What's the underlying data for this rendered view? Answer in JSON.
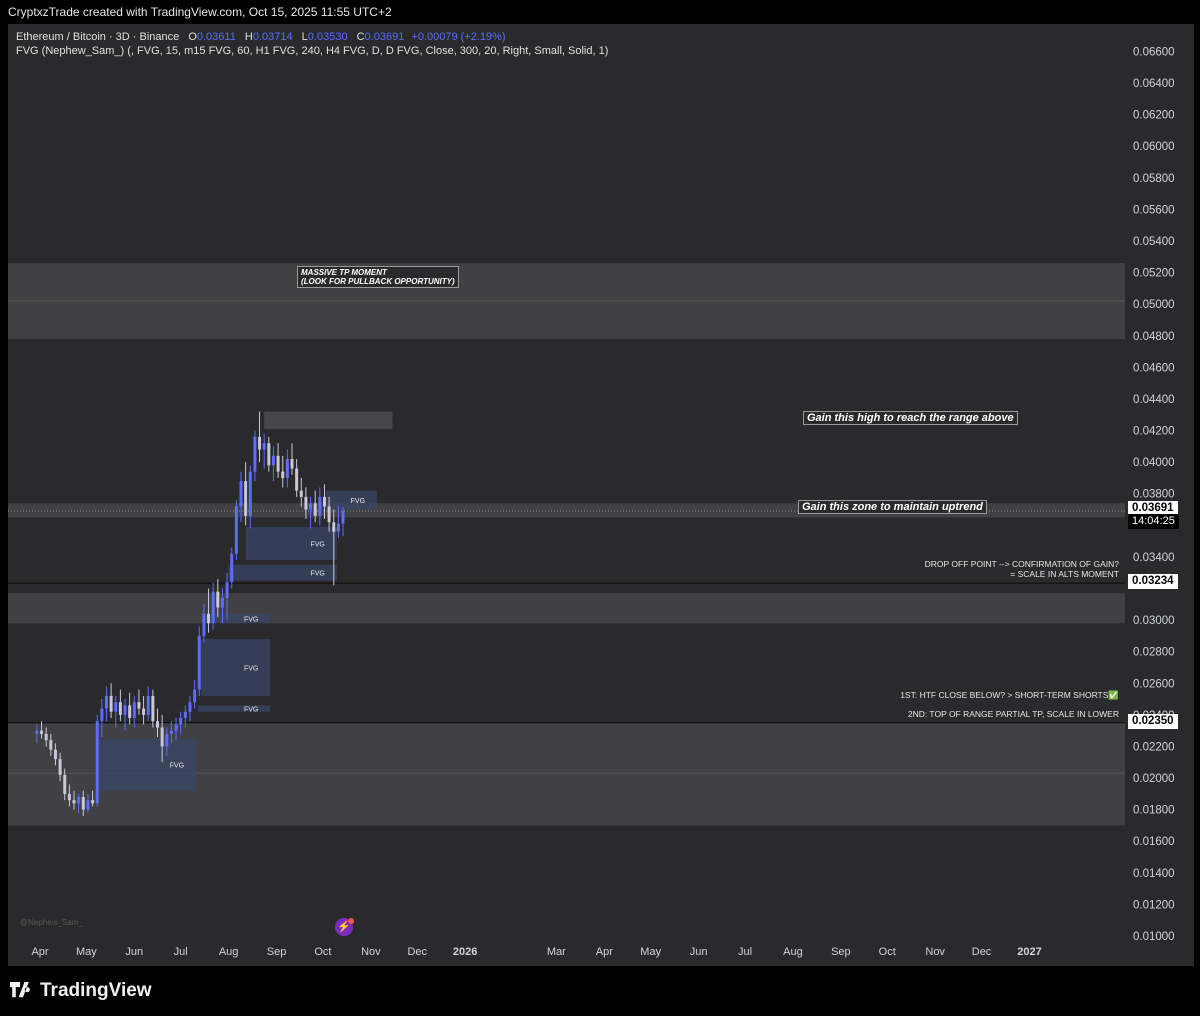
{
  "attribution": "CryptxzTrade created with TradingView.com, Oct 15, 2025 11:55 UTC+2",
  "legend": {
    "symbol": "Ethereum / Bitcoin · 3D · Binance",
    "open_label": "O",
    "open": "0.03611",
    "high_label": "H",
    "high": "0.03714",
    "low_label": "L",
    "low": "0.03530",
    "close_label": "C",
    "close": "0.03691",
    "change": "+0.00079 (+2.19%)",
    "indicator": "FVG (Nephew_Sam_) (, FVG, 15, m15 FVG, 60, H1 FVG, 240, H4 FVG, D, D FVG, Close, 300, 20, Right, Small, Solid, 1)"
  },
  "annotations": {
    "massive_tp_line1": "MASSIVE TP MOMENT",
    "massive_tp_line2": "(LOOK FOR PULLBACK OPPORTUNITY)",
    "gain_high": "Gain this high to reach the range above",
    "gain_zone": "Gain this zone to maintain uptrend",
    "drop_off_line1": "DROP OFF POINT -->  CONFIRMATION OF GAIN?",
    "drop_off_line2": "= SCALE IN ALTS MOMENT",
    "first_note": "1ST: HTF CLOSE BELOW? > SHORT-TERM SHORTS✅",
    "second_note": "2ND: TOP OF RANGE PARTIAL TP, SCALE IN LOWER",
    "fvg_label": "FVG"
  },
  "price_tags": {
    "current": "0.03691",
    "countdown": "14:04:25",
    "drop_level": "0.03234",
    "range_top": "0.02350"
  },
  "watermark": "@Nephew_Sam_",
  "brand": "TradingView",
  "colors": {
    "background": "#2a2a2c",
    "candle_up": "#5b6cff",
    "candle_down": "#c8c8d8",
    "fvg_fill": "#3a4566",
    "zone_fill": "#4a4a4c"
  },
  "chart_data": {
    "type": "candlestick",
    "symbol": "ETH/BTC",
    "timeframe": "3D",
    "y_axis": {
      "range": [
        0.01,
        0.0666
      ],
      "tick_labels": [
        "0.06600",
        "0.06400",
        "0.06200",
        "0.06000",
        "0.05800",
        "0.05600",
        "0.05400",
        "0.05200",
        "0.05000",
        "0.04800",
        "0.04600",
        "0.04400",
        "0.04200",
        "0.04000",
        "0.03800",
        "0.03400",
        "0.03000",
        "0.02800",
        "0.02600",
        "0.02400",
        "0.02200",
        "0.02000",
        "0.01800",
        "0.01600",
        "0.01400",
        "0.01200",
        "0.01000"
      ],
      "tick_values": [
        0.066,
        0.064,
        0.062,
        0.06,
        0.058,
        0.056,
        0.054,
        0.052,
        0.05,
        0.048,
        0.046,
        0.044,
        0.042,
        0.04,
        0.038,
        0.034,
        0.03,
        0.028,
        0.026,
        0.024,
        0.022,
        0.02,
        0.018,
        0.016,
        0.014,
        0.012,
        0.01
      ]
    },
    "x_axis": {
      "tick_labels": [
        "Apr",
        "May",
        "Jun",
        "Jul",
        "Aug",
        "Sep",
        "Oct",
        "Nov",
        "Dec",
        "2026",
        "Mar",
        "Apr",
        "May",
        "Jun",
        "Jul",
        "Aug",
        "Sep",
        "Oct",
        "Nov",
        "Dec",
        "2027"
      ],
      "tick_months": [
        "2025-04",
        "2025-05",
        "2025-06",
        "2025-07",
        "2025-08",
        "2025-09",
        "2025-10",
        "2025-11",
        "2025-12",
        "2026-01",
        "2026-03",
        "2026-04",
        "2026-05",
        "2026-06",
        "2026-07",
        "2026-08",
        "2026-09",
        "2026-10",
        "2026-11",
        "2026-12",
        "2027-01"
      ],
      "bold_labels": [
        "2026",
        "2027"
      ]
    },
    "zones": [
      {
        "name": "massive-tp-zone",
        "from": 0.0478,
        "to": 0.0526
      },
      {
        "name": "high-zone",
        "from": 0.0421,
        "to": 0.0432,
        "start": "2025-08-24",
        "end": "2025-11-15"
      },
      {
        "name": "uptrend-zone",
        "from": 0.0365,
        "to": 0.0374
      },
      {
        "name": "drop-off-zone",
        "from": 0.0298,
        "to": 0.0317
      },
      {
        "name": "bottom-range",
        "from": 0.017,
        "to": 0.0235
      }
    ],
    "levels": [
      {
        "name": "current-close",
        "value": 0.03691
      },
      {
        "name": "drop-off-line",
        "value": 0.03234
      },
      {
        "name": "range-top-line",
        "value": 0.0235
      }
    ],
    "fvgs": [
      {
        "start": "2025-10-03",
        "end": "2025-11-05",
        "from": 0.037,
        "to": 0.0382
      },
      {
        "start": "2025-08-12",
        "end": "2025-10-10",
        "from": 0.0338,
        "to": 0.0359
      },
      {
        "start": "2025-08-01",
        "end": "2025-10-10",
        "from": 0.0325,
        "to": 0.0335
      },
      {
        "start": "2025-07-16",
        "end": "2025-08-28",
        "from": 0.0298,
        "to": 0.0304
      },
      {
        "start": "2025-07-14",
        "end": "2025-08-28",
        "from": 0.0252,
        "to": 0.0288
      },
      {
        "start": "2025-07-12",
        "end": "2025-08-28",
        "from": 0.0242,
        "to": 0.0246
      },
      {
        "start": "2025-05-08",
        "end": "2025-07-11",
        "from": 0.0192,
        "to": 0.0225
      }
    ],
    "ohlc": [
      [
        "2025-03-30",
        0.0228,
        0.0234,
        0.0222,
        0.023
      ],
      [
        "2025-04-02",
        0.023,
        0.0236,
        0.0225,
        0.0228
      ],
      [
        "2025-04-05",
        0.0228,
        0.0232,
        0.022,
        0.0224
      ],
      [
        "2025-04-08",
        0.0224,
        0.0228,
        0.0214,
        0.0218
      ],
      [
        "2025-04-11",
        0.0218,
        0.0222,
        0.0208,
        0.0212
      ],
      [
        "2025-04-14",
        0.0212,
        0.0216,
        0.0198,
        0.0202
      ],
      [
        "2025-04-17",
        0.0202,
        0.0206,
        0.0186,
        0.019
      ],
      [
        "2025-04-20",
        0.019,
        0.0196,
        0.0182,
        0.0186
      ],
      [
        "2025-04-23",
        0.0186,
        0.0192,
        0.018,
        0.0184
      ],
      [
        "2025-04-26",
        0.0184,
        0.019,
        0.0178,
        0.0188
      ],
      [
        "2025-04-29",
        0.0188,
        0.0192,
        0.0176,
        0.018
      ],
      [
        "2025-05-02",
        0.018,
        0.019,
        0.0178,
        0.0186
      ],
      [
        "2025-05-05",
        0.0186,
        0.0192,
        0.0182,
        0.0184
      ],
      [
        "2025-05-08",
        0.0184,
        0.024,
        0.0182,
        0.0236
      ],
      [
        "2025-05-11",
        0.0236,
        0.025,
        0.0226,
        0.0244
      ],
      [
        "2025-05-14",
        0.0244,
        0.0258,
        0.0236,
        0.0252
      ],
      [
        "2025-05-17",
        0.0252,
        0.026,
        0.0238,
        0.0242
      ],
      [
        "2025-05-20",
        0.0242,
        0.0252,
        0.0232,
        0.0248
      ],
      [
        "2025-05-23",
        0.0248,
        0.0256,
        0.0236,
        0.024
      ],
      [
        "2025-05-26",
        0.024,
        0.025,
        0.023,
        0.0246
      ],
      [
        "2025-05-29",
        0.0246,
        0.0254,
        0.0234,
        0.0238
      ],
      [
        "2025-06-01",
        0.0238,
        0.0252,
        0.0232,
        0.0248
      ],
      [
        "2025-06-04",
        0.0248,
        0.0256,
        0.024,
        0.0244
      ],
      [
        "2025-06-07",
        0.0244,
        0.0252,
        0.0234,
        0.024
      ],
      [
        "2025-06-10",
        0.024,
        0.0258,
        0.0236,
        0.0252
      ],
      [
        "2025-06-13",
        0.0252,
        0.0256,
        0.0232,
        0.0236
      ],
      [
        "2025-06-16",
        0.0236,
        0.0244,
        0.0226,
        0.0232
      ],
      [
        "2025-06-19",
        0.0232,
        0.024,
        0.021,
        0.022
      ],
      [
        "2025-06-22",
        0.022,
        0.0232,
        0.0214,
        0.0228
      ],
      [
        "2025-06-25",
        0.0228,
        0.0236,
        0.0222,
        0.023
      ],
      [
        "2025-06-28",
        0.023,
        0.0238,
        0.0224,
        0.0234
      ],
      [
        "2025-07-01",
        0.0234,
        0.0242,
        0.0228,
        0.0238
      ],
      [
        "2025-07-04",
        0.0238,
        0.0246,
        0.0232,
        0.0242
      ],
      [
        "2025-07-07",
        0.0242,
        0.0252,
        0.0236,
        0.0248
      ],
      [
        "2025-07-10",
        0.0248,
        0.0262,
        0.0244,
        0.0256
      ],
      [
        "2025-07-13",
        0.0256,
        0.0296,
        0.0252,
        0.029
      ],
      [
        "2025-07-16",
        0.029,
        0.031,
        0.0286,
        0.0304
      ],
      [
        "2025-07-19",
        0.0304,
        0.032,
        0.0292,
        0.0298
      ],
      [
        "2025-07-22",
        0.0298,
        0.0324,
        0.0294,
        0.0318
      ],
      [
        "2025-07-25",
        0.0318,
        0.0326,
        0.0302,
        0.0308
      ],
      [
        "2025-07-28",
        0.0308,
        0.032,
        0.0298,
        0.0314
      ],
      [
        "2025-07-31",
        0.0314,
        0.033,
        0.03,
        0.0324
      ],
      [
        "2025-08-03",
        0.0324,
        0.0346,
        0.032,
        0.0342
      ],
      [
        "2025-08-06",
        0.0342,
        0.0376,
        0.0338,
        0.0372
      ],
      [
        "2025-08-09",
        0.0372,
        0.0394,
        0.0362,
        0.0388
      ],
      [
        "2025-08-12",
        0.0388,
        0.04,
        0.036,
        0.0366
      ],
      [
        "2025-08-15",
        0.0366,
        0.0398,
        0.0358,
        0.0394
      ],
      [
        "2025-08-18",
        0.0394,
        0.042,
        0.0388,
        0.0416
      ],
      [
        "2025-08-21",
        0.0416,
        0.0432,
        0.04,
        0.0408
      ],
      [
        "2025-08-24",
        0.0408,
        0.0418,
        0.0396,
        0.0412
      ],
      [
        "2025-08-27",
        0.0412,
        0.0416,
        0.0394,
        0.0398
      ],
      [
        "2025-08-30",
        0.0398,
        0.041,
        0.0388,
        0.0404
      ],
      [
        "2025-09-02",
        0.0404,
        0.0412,
        0.039,
        0.0394
      ],
      [
        "2025-09-05",
        0.0394,
        0.0404,
        0.0384,
        0.039
      ],
      [
        "2025-09-08",
        0.039,
        0.0408,
        0.0384,
        0.0402
      ],
      [
        "2025-09-11",
        0.0402,
        0.0412,
        0.0392,
        0.0396
      ],
      [
        "2025-09-14",
        0.0396,
        0.0402,
        0.0378,
        0.0382
      ],
      [
        "2025-09-17",
        0.0382,
        0.039,
        0.0372,
        0.0378
      ],
      [
        "2025-09-20",
        0.0378,
        0.0384,
        0.0364,
        0.037
      ],
      [
        "2025-09-23",
        0.037,
        0.0378,
        0.0358,
        0.0374
      ],
      [
        "2025-09-26",
        0.0374,
        0.0382,
        0.0362,
        0.0366
      ],
      [
        "2025-09-29",
        0.0366,
        0.0384,
        0.036,
        0.0378
      ],
      [
        "2025-10-02",
        0.0378,
        0.0386,
        0.0364,
        0.0372
      ],
      [
        "2025-10-05",
        0.0372,
        0.0378,
        0.0356,
        0.0362
      ],
      [
        "2025-10-08",
        0.0362,
        0.037,
        0.0322,
        0.0356
      ],
      [
        "2025-10-11",
        0.0356,
        0.0372,
        0.0352,
        0.0361
      ],
      [
        "2025-10-14",
        0.03611,
        0.03714,
        0.0353,
        0.03691
      ]
    ]
  }
}
